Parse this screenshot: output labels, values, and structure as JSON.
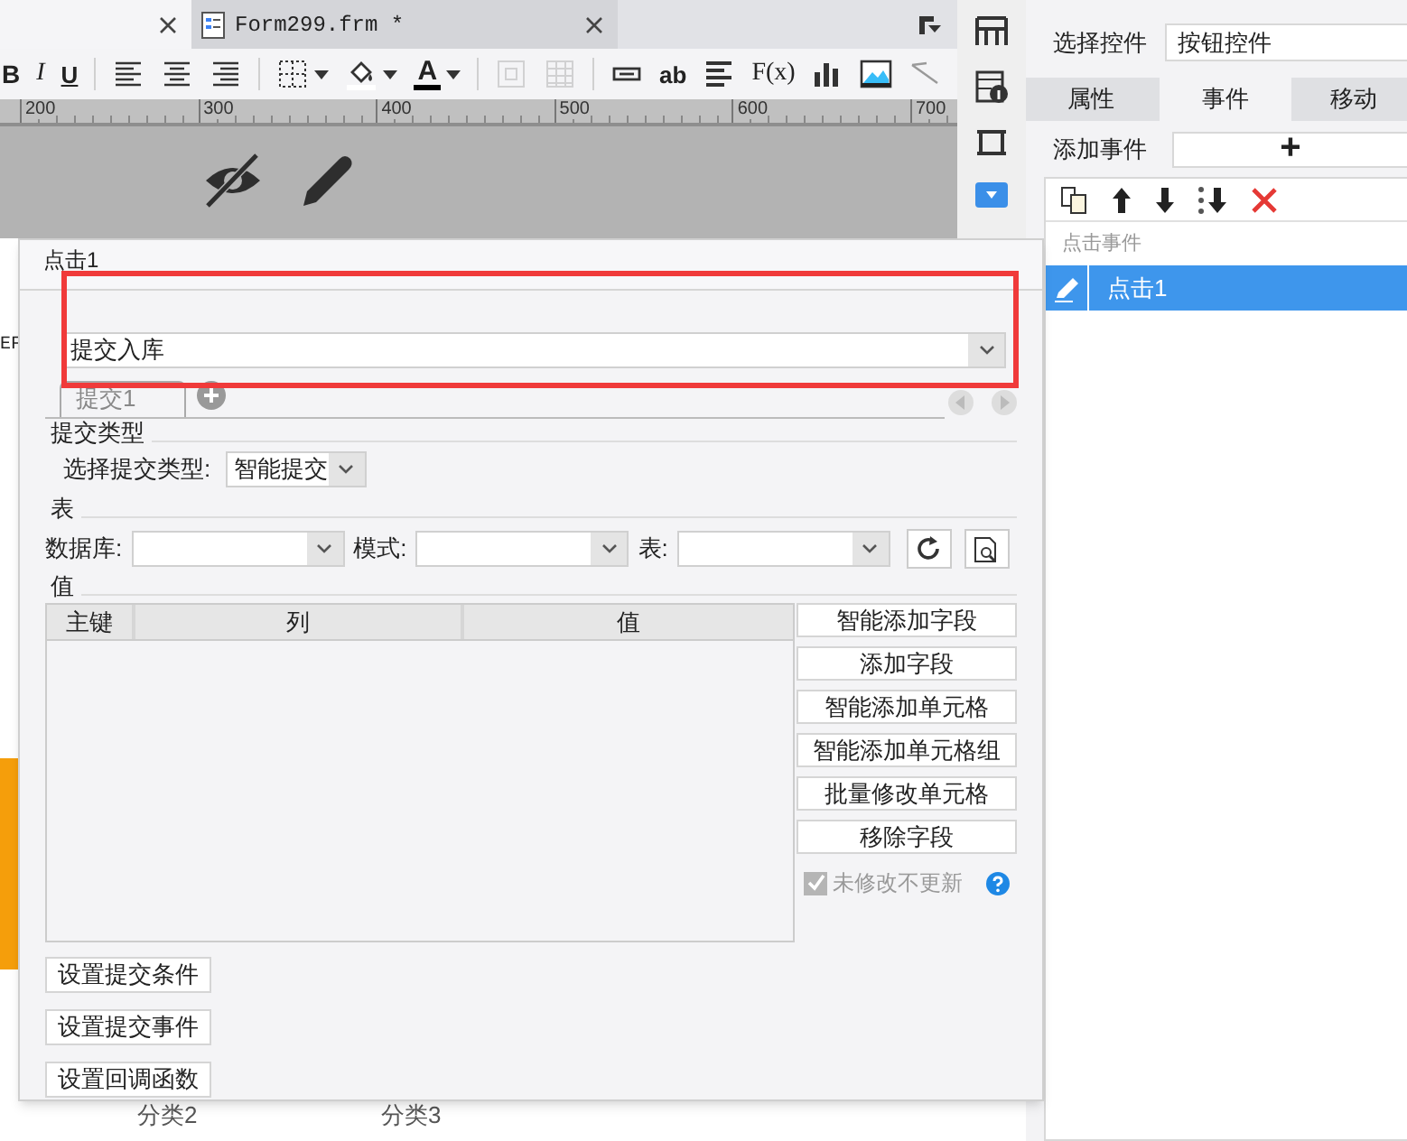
{
  "editor_tabs": [
    {
      "selected": true
    },
    {
      "label": "Form299.frm *",
      "selected": false
    }
  ],
  "toolbar": [
    {
      "kind": "text",
      "label": "B"
    },
    {
      "kind": "text",
      "label": "I"
    },
    {
      "kind": "text",
      "label": "U"
    },
    {
      "kind": "sep"
    },
    {
      "kind": "icon"
    },
    {
      "kind": "icon"
    },
    {
      "kind": "icon"
    },
    {
      "kind": "sep"
    },
    {
      "kind": "icon",
      "caret": true
    },
    {
      "kind": "icon",
      "caret": true
    },
    {
      "kind": "text",
      "label": "A",
      "caret": true
    },
    {
      "kind": "sep"
    },
    {
      "kind": "icon",
      "disabled": true
    },
    {
      "kind": "icon",
      "disabled": true
    },
    {
      "kind": "sep"
    },
    {
      "kind": "icon"
    },
    {
      "kind": "text",
      "label": "ab"
    },
    {
      "kind": "icon"
    },
    {
      "kind": "text",
      "label": "F(x)"
    },
    {
      "kind": "icon"
    },
    {
      "kind": "icon"
    },
    {
      "kind": "icon"
    }
  ],
  "ruler": [
    "200",
    "300",
    "400",
    "500",
    "600",
    "700"
  ],
  "background_cells": [
    "EF",
    "分类2",
    "分类3"
  ],
  "right_panel": {
    "select_control": {
      "label": "选择控件",
      "value": "按钮控件"
    },
    "tabs": [
      {
        "label": "属性",
        "selected": false
      },
      {
        "label": "事件",
        "selected": true
      },
      {
        "label": "移动",
        "selected": false
      }
    ],
    "add_event": {
      "label": "添加事件",
      "button": "+"
    },
    "events": {
      "header": "点击事件",
      "items": [
        {
          "label": "点击1",
          "selected": true
        }
      ]
    }
  },
  "dialog": {
    "title": "点击1",
    "action": "提交入库",
    "submit_tabs": [
      {
        "label": "提交1",
        "selected": true
      }
    ],
    "submit_type": {
      "heading": "提交类型",
      "label": "选择提交类型:",
      "value": "智能提交"
    },
    "table_section": {
      "heading": "表",
      "fields": [
        {
          "label": "数据库:"
        },
        {
          "label": "模式:"
        },
        {
          "label": "表:"
        }
      ]
    },
    "values": {
      "heading": "值",
      "columns": [
        "主键",
        "列",
        "值"
      ],
      "buttons": [
        "智能添加字段",
        "添加字段",
        "智能添加单元格",
        "智能添加单元格组",
        "批量修改单元格",
        "移除字段"
      ],
      "checkbox": {
        "label": "未修改不更新",
        "checked": true,
        "disabled": true
      }
    },
    "bottom_buttons": [
      "设置提交条件",
      "设置提交事件",
      "设置回调函数"
    ]
  }
}
